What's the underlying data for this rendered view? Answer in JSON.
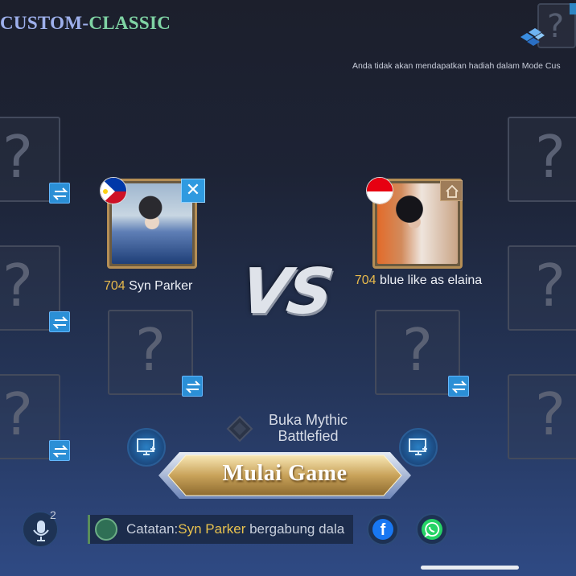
{
  "header": {
    "mode_part1": "CUSTOM",
    "mode_sep": "-",
    "mode_part2": "CLASSIC",
    "notice": "Anda tidak akan mendapatkan hadiah dalam Mode Cus",
    "corner_slot_glyph": "?"
  },
  "slot_glyph": "?",
  "team_left": {
    "player": {
      "level": "704",
      "name": "Syn Parker",
      "flag": "philippines-flag",
      "action_icon": "close-icon"
    }
  },
  "team_right": {
    "player": {
      "level": "704",
      "name": "blue like as elaina",
      "flag": "indonesia-flag",
      "action_icon": "home-icon"
    }
  },
  "vs_label": "VS",
  "mythic": {
    "label": "Buka Mythic Battlefied"
  },
  "start_button": {
    "label": "Mulai Game"
  },
  "mic": {
    "count": "2"
  },
  "chat": {
    "prefix": "Catatan:",
    "player": "Syn Parker",
    "message": " bergabung dala"
  },
  "colors": {
    "accent_blue": "#2b8fd6",
    "gold": "#e7b94c",
    "title_green": "#7fd3a4",
    "title_blue": "#9eb0ec"
  }
}
